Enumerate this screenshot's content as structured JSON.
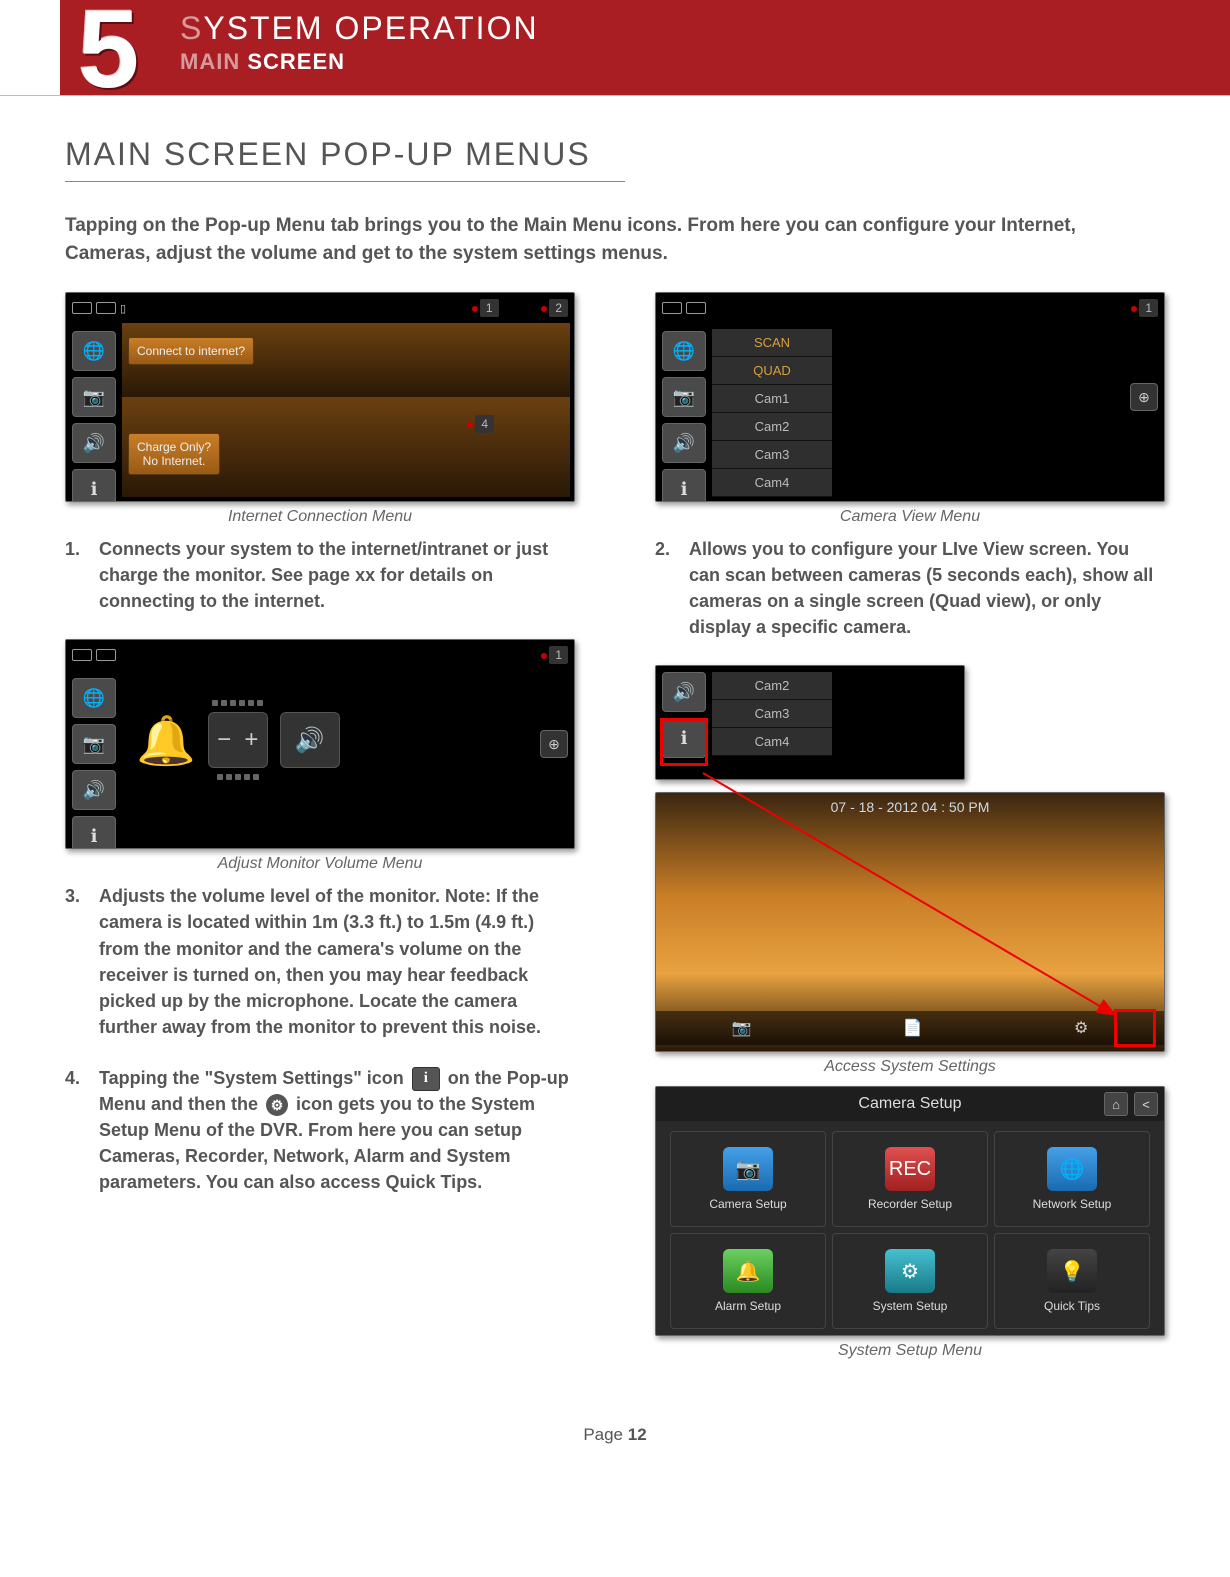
{
  "header": {
    "chapter_number": "5",
    "title_pre": "S",
    "title_rest": "YSTEM OPERATION",
    "sub_pre": "MAIN",
    "sub_rest": " SCREEN"
  },
  "section_title": "MAIN SCREEN POP-UP MENUS",
  "intro": "Tapping on the Pop-up Menu tab brings you to the Main Menu icons. From here you can configure your Internet, Cameras, adjust the volume and get to the system settings menus.",
  "captions": {
    "internet": "Internet Connection Menu",
    "camera": "Camera View Menu",
    "volume": "Adjust Monitor Volume Menu",
    "access": "Access System Settings",
    "setup": "System Setup Menu"
  },
  "items": {
    "one": {
      "n": "1.",
      "text": "Connects your system to the internet/intranet or just charge the monitor. See page xx for details on connecting to the internet."
    },
    "two": {
      "n": "2.",
      "text": "Allows you to configure your LIve View screen. You can scan between cameras (5 seconds each), show all cameras on a single screen (Quad view), or only display a specific camera."
    },
    "three": {
      "n": "3.",
      "text": "Adjusts the volume level of the monitor. Note: If the camera is located within 1m (3.3 ft.) to 1.5m (4.9 ft.) from the monitor and the camera's volume on the receiver is turned on, then you may hear feedback picked up by the microphone. Locate the camera further away from the monitor to prevent this noise."
    },
    "four": {
      "n": "4.",
      "text_a": "Tapping the \"System Settings\" icon ",
      "text_b": " on the Pop-up Menu and then the ",
      "text_c": " icon gets you to the System Setup Menu of the DVR. From here you can setup Cameras, Recorder, Network, Alarm and System parameters. You can also access Quick Tips."
    }
  },
  "screenshots": {
    "internet_popup1": "Connect to internet?",
    "internet_popup2": "Charge Only?\nNo Internet.",
    "cam_badges": {
      "c1": "1",
      "c2": "2",
      "c4": "4"
    },
    "cam_menu": [
      "SCAN",
      "QUAD",
      "Cam1",
      "Cam2",
      "Cam3",
      "Cam4"
    ],
    "strip": [
      "Cam2",
      "Cam3",
      "Cam4"
    ],
    "access_date": "07 - 18 - 2012 04 : 50 PM",
    "setup_title": "Camera Setup",
    "setup_tiles": [
      "Camera Setup",
      "Recorder Setup",
      "Network Setup",
      "Alarm Setup",
      "System Setup",
      "Quick Tips"
    ],
    "rec_label": "REC"
  },
  "footer": {
    "label": "Page",
    "number": "12"
  }
}
